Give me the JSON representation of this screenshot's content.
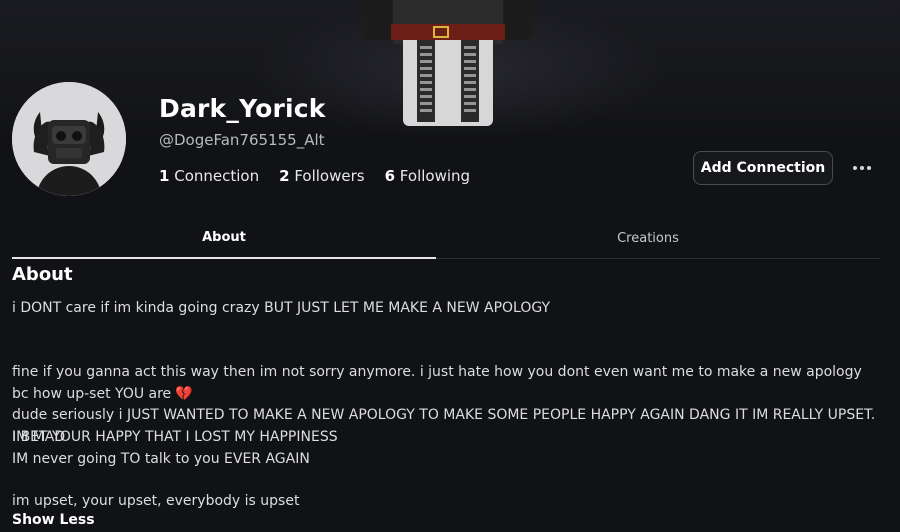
{
  "profile": {
    "display_name": "Dark_Yorick",
    "username": "@DogeFan765155_Alt",
    "stats": [
      {
        "count": "1",
        "label": "Connection"
      },
      {
        "count": "2",
        "label": "Followers"
      },
      {
        "count": "6",
        "label": "Following"
      }
    ]
  },
  "actions": {
    "add_connection_label": "Add Connection",
    "more_icon": "more-horizontal-icon"
  },
  "tabs": [
    {
      "label": "About",
      "active": true
    },
    {
      "label": "Creations",
      "active": false
    }
  ],
  "about": {
    "heading": "About",
    "line1": "i DONT care if im kinda going crazy BUT JUST LET ME MAKE A NEW APOLOGY",
    "line2": "fine if you ganna act this way then im not sorry anymore. i just hate how you dont even want me to make a new apology bc how up-set YOU are",
    "line2_emoji": "💔",
    "line3": "dude seriously i JUST WANTED TO MAKE A NEW APOLOGY TO MAKE SOME PEOPLE HAPPY AGAIN DANG IT IM REALLY UPSET. IM MAD",
    "line4": "I BET YOUR HAPPY THAT I LOST MY HAPPINESS",
    "line5": "IM never going TO talk to you EVER AGAIN",
    "line6": "im upset, your upset, everybody is upset",
    "show_less_label": "Show Less"
  },
  "colors": {
    "background": "#111216",
    "accent_heart": "#e0508c"
  }
}
